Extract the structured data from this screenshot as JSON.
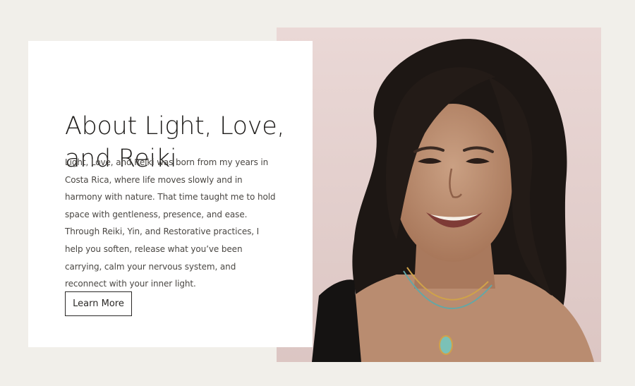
{
  "about": {
    "heading": "About Light, Love, and Reiki",
    "body": "Light, Love, and Reiki was born from my years in Costa Rica, where life moves slowly and in harmony with nature. That time taught me to hold space with gentleness, presence, and ease. Through Reiki, Yin, and Restorative practices, I help you soften, release what you’ve been carrying, calm your nervous system, and reconnect with your inner light.",
    "cta_label": "Learn More"
  },
  "photo": {
    "subject": "portrait-of-smiling-woman"
  },
  "colors": {
    "page_background": "#f1efea",
    "card_background": "#ffffff",
    "photo_background": "#e6d3d1",
    "text_dark": "#1f1d1b",
    "text_body": "#4a4743"
  }
}
